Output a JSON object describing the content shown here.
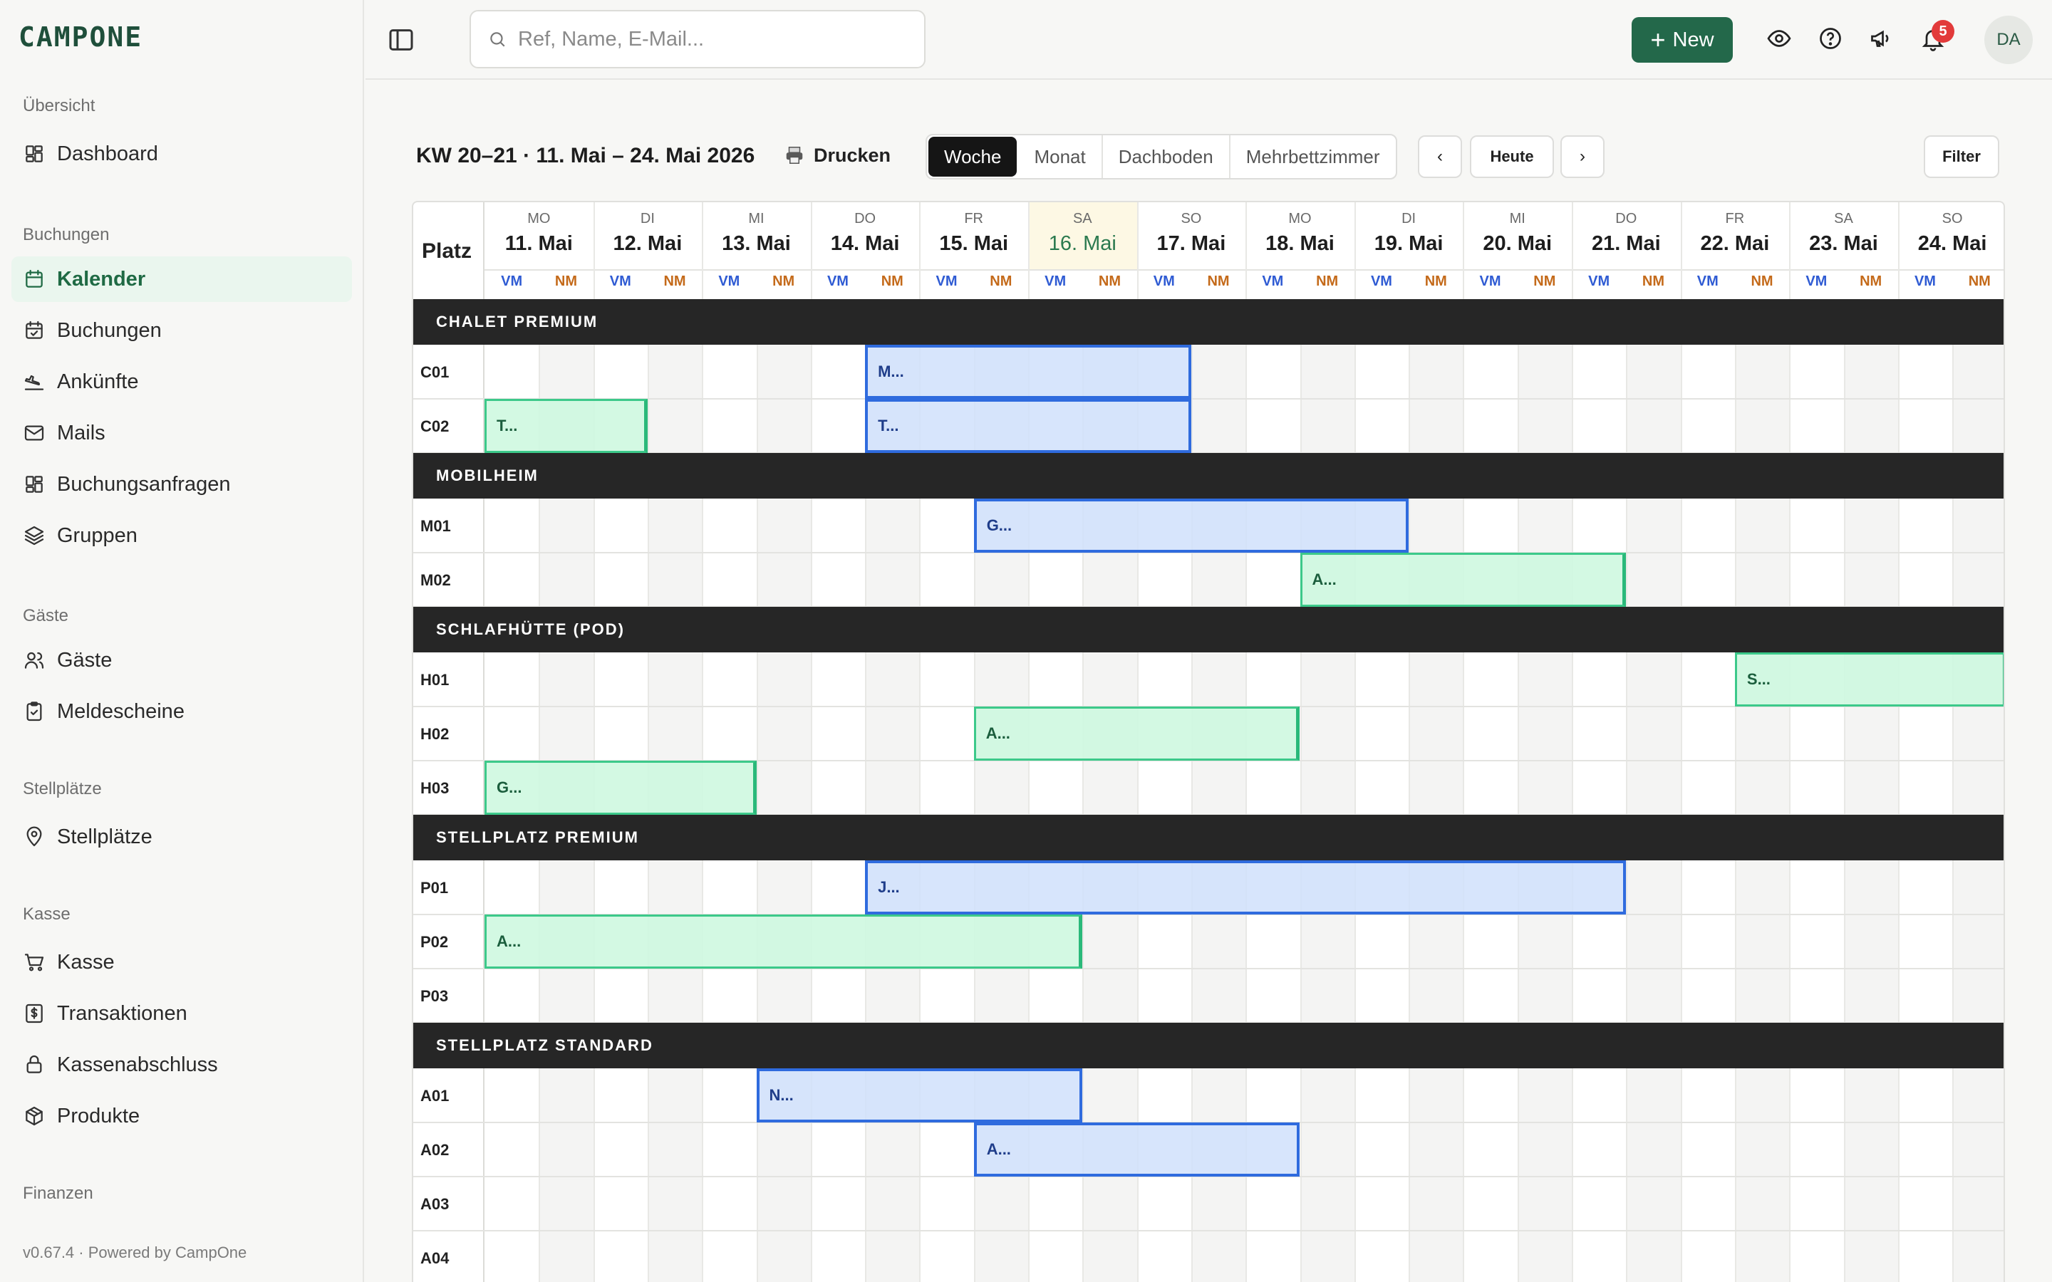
{
  "app": {
    "logo": "CAMPONE",
    "version": "v0.67.4 · Powered by CampOne"
  },
  "sidebar": {
    "groups": [
      {
        "label": "Übersicht",
        "items": [
          {
            "label": "Dashboard",
            "icon": "dashboard-icon"
          }
        ]
      },
      {
        "label": "Buchungen",
        "items": [
          {
            "label": "Kalender",
            "icon": "calendar-icon",
            "active": true
          },
          {
            "label": "Buchungen",
            "icon": "calendar-check-icon"
          },
          {
            "label": "Ankünfte",
            "icon": "plane-landing-icon"
          },
          {
            "label": "Mails",
            "icon": "mail-icon"
          },
          {
            "label": "Buchungsanfragen",
            "icon": "grid-icon"
          },
          {
            "label": "Gruppen",
            "icon": "layers-icon"
          }
        ]
      },
      {
        "label": "Gäste",
        "items": [
          {
            "label": "Gäste",
            "icon": "users-icon"
          },
          {
            "label": "Meldescheine",
            "icon": "clipboard-check-icon"
          }
        ]
      },
      {
        "label": "Stellplätze",
        "items": [
          {
            "label": "Stellplätze",
            "icon": "map-pin-icon"
          }
        ]
      },
      {
        "label": "Kasse",
        "items": [
          {
            "label": "Kasse",
            "icon": "cart-icon"
          },
          {
            "label": "Transaktionen",
            "icon": "receipt-icon"
          },
          {
            "label": "Kassenabschluss",
            "icon": "lock-icon"
          },
          {
            "label": "Produkte",
            "icon": "package-icon"
          }
        ]
      },
      {
        "label": "Finanzen",
        "items": []
      }
    ]
  },
  "header": {
    "search_placeholder": "Ref, Name, E-Mail...",
    "new_label": "New",
    "notification_count": "5",
    "avatar_initials": "DA"
  },
  "toolbar": {
    "week_title": "KW 20–21 · 11. Mai – 24. Mai 2026",
    "print_label": "Drucken",
    "view_tabs": [
      "Woche",
      "Monat",
      "Dachboden",
      "Mehrbettzimmer"
    ],
    "active_view": "Woche",
    "prev_label": "‹",
    "today_label": "Heute",
    "next_label": "›",
    "filter_label": "Filter"
  },
  "calendar": {
    "platz_label": "Platz",
    "half_labels": [
      "VM",
      "NM"
    ],
    "today_index": 5,
    "days": [
      {
        "abbr": "MO",
        "date": "11. Mai"
      },
      {
        "abbr": "DI",
        "date": "12. Mai"
      },
      {
        "abbr": "MI",
        "date": "13. Mai"
      },
      {
        "abbr": "DO",
        "date": "14. Mai"
      },
      {
        "abbr": "FR",
        "date": "15. Mai"
      },
      {
        "abbr": "SA",
        "date": "16. Mai"
      },
      {
        "abbr": "SO",
        "date": "17. Mai"
      },
      {
        "abbr": "MO",
        "date": "18. Mai"
      },
      {
        "abbr": "DI",
        "date": "19. Mai"
      },
      {
        "abbr": "MI",
        "date": "20. Mai"
      },
      {
        "abbr": "DO",
        "date": "21. Mai"
      },
      {
        "abbr": "FR",
        "date": "22. Mai"
      },
      {
        "abbr": "SA",
        "date": "23. Mai"
      },
      {
        "abbr": "SO",
        "date": "24. Mai"
      }
    ],
    "groups": [
      {
        "name": "CHALET PREMIUM",
        "units": [
          {
            "id": "C01",
            "bookings": [
              {
                "label": "M...",
                "start": 7,
                "end": 13,
                "color": "blue"
              }
            ]
          },
          {
            "id": "C02",
            "bookings": [
              {
                "label": "T...",
                "start": 0,
                "end": 3,
                "color": "green"
              },
              {
                "label": "T...",
                "start": 7,
                "end": 13,
                "color": "blue"
              }
            ]
          }
        ]
      },
      {
        "name": "MOBILHEIM",
        "units": [
          {
            "id": "M01",
            "bookings": [
              {
                "label": "G...",
                "start": 9,
                "end": 17,
                "color": "blue"
              }
            ]
          },
          {
            "id": "M02",
            "bookings": [
              {
                "label": "A...",
                "start": 15,
                "end": 21,
                "color": "green"
              }
            ]
          }
        ]
      },
      {
        "name": "SCHLAFHÜTTE (POD)",
        "units": [
          {
            "id": "H01",
            "bookings": [
              {
                "label": "S...",
                "start": 23,
                "end": 28,
                "color": "green"
              }
            ]
          },
          {
            "id": "H02",
            "bookings": [
              {
                "label": "A...",
                "start": 9,
                "end": 15,
                "color": "green"
              }
            ]
          },
          {
            "id": "H03",
            "bookings": [
              {
                "label": "G...",
                "start": 0,
                "end": 5,
                "color": "green"
              }
            ]
          }
        ]
      },
      {
        "name": "STELLPLATZ PREMIUM",
        "units": [
          {
            "id": "P01",
            "bookings": [
              {
                "label": "J...",
                "start": 7,
                "end": 21,
                "color": "blue"
              }
            ]
          },
          {
            "id": "P02",
            "bookings": [
              {
                "label": "A...",
                "start": 0,
                "end": 11,
                "color": "green"
              }
            ]
          },
          {
            "id": "P03",
            "bookings": []
          }
        ]
      },
      {
        "name": "STELLPLATZ STANDARD",
        "units": [
          {
            "id": "A01",
            "bookings": [
              {
                "label": "N...",
                "start": 5,
                "end": 11,
                "color": "blue"
              }
            ]
          },
          {
            "id": "A02",
            "bookings": [
              {
                "label": "A...",
                "start": 9,
                "end": 15,
                "color": "blue"
              }
            ]
          },
          {
            "id": "A03",
            "bookings": []
          },
          {
            "id": "A04",
            "bookings": []
          }
        ]
      }
    ]
  }
}
